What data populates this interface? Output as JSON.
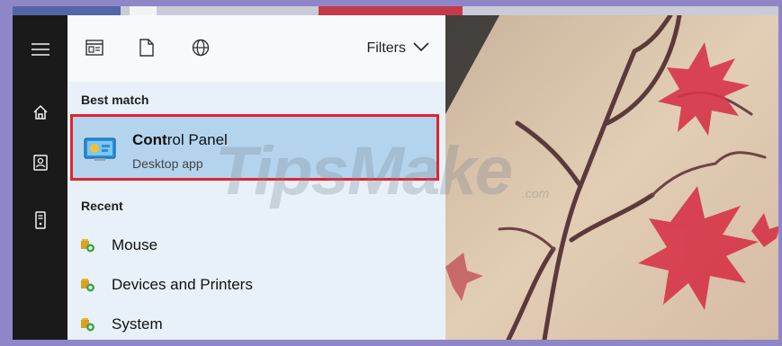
{
  "filter_bar": {
    "filters_label": "Filters",
    "icons": [
      "apps-icon",
      "document-icon",
      "web-globe-icon"
    ]
  },
  "rail": {
    "icons": [
      "hamburger-menu-icon",
      "home-icon",
      "document-user-icon",
      "tower-pc-icon"
    ]
  },
  "best_match": {
    "section_label": "Best match",
    "app_name_bold": "Cont",
    "app_name_rest": "rol Panel",
    "app_type": "Desktop app",
    "icon": "control-panel-icon",
    "highlight_color": "#e3232c"
  },
  "recent": {
    "section_label": "Recent",
    "items": [
      {
        "label": "Mouse",
        "icon": "control-panel-item-icon"
      },
      {
        "label": "Devices and Printers",
        "icon": "control-panel-item-icon"
      },
      {
        "label": "System",
        "icon": "control-panel-item-icon"
      }
    ]
  },
  "watermark": {
    "text": "TipsMake",
    "suffix": ".com"
  }
}
